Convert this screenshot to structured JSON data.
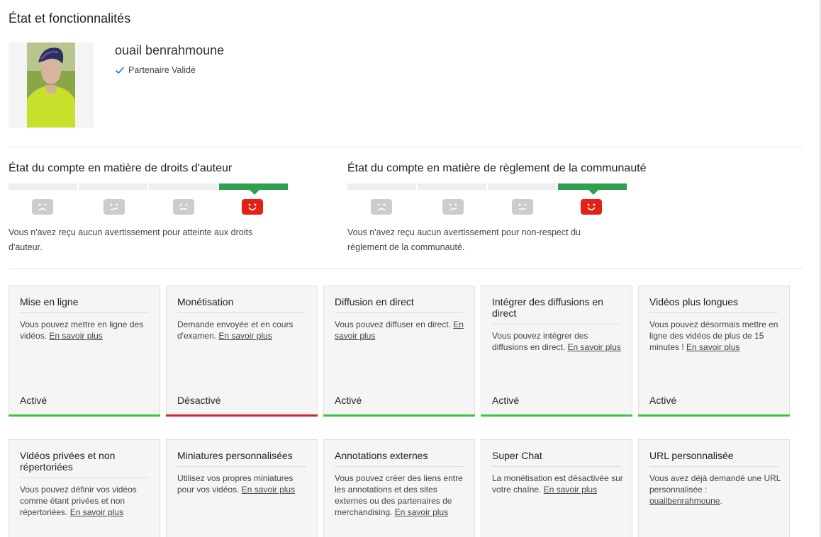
{
  "page": {
    "title": "État et fonctionnalités"
  },
  "channel": {
    "name": "ouail benrahmoune",
    "partner_label": "Partenaire Validé"
  },
  "copyright": {
    "title": "État du compte en matière de droits d'auteur",
    "text": "Vous n'avez reçu aucun avertissement pour atteinte aux droits d'auteur."
  },
  "community": {
    "title": "État du compte en matière de règlement de la communauté",
    "text": "Vous n'avez reçu aucun avertissement pour non-respect du règlement de la communauté."
  },
  "learn_more": "En savoir plus",
  "features": [
    {
      "title": "Mise en ligne",
      "desc": "Vous pouvez mettre en ligne des vidéos.",
      "link": "En savoir plus",
      "status": "Activé",
      "status_color": "#3ec43e"
    },
    {
      "title": "Monétisation",
      "desc": "Demande envoyée et en cours d'examen.",
      "link": "En savoir plus",
      "status": "Désactivé",
      "status_color": "#d32626"
    },
    {
      "title": "Diffusion en direct",
      "desc": "Vous pouvez diffuser en direct.",
      "link": "En savoir plus",
      "status": "Activé",
      "status_color": "#3ec43e"
    },
    {
      "title": "Intégrer des diffusions en direct",
      "desc": "Vous pouvez intégrer des diffusions en direct.",
      "link": "En savoir plus",
      "status": "Activé",
      "status_color": "#3ec43e"
    },
    {
      "title": "Vidéos plus longues",
      "desc": "Vous pouvez désormais mettre en ligne des vidéos de plus de 15 minutes !",
      "link": "En savoir plus",
      "status": "Activé",
      "status_color": "#3ec43e"
    },
    {
      "title": "Vidéos privées et non répertoriées",
      "desc": "Vous pouvez définir vos vidéos comme étant privées et non répertoriées.",
      "link": "En savoir plus"
    },
    {
      "title": "Miniatures personnalisées",
      "desc": "Utilisez vos propres miniatures pour vos vidéos.",
      "link": "En savoir plus"
    },
    {
      "title": "Annotations externes",
      "desc": "Vous pouvez créer des liens entre les annotations et des sites externes ou des partenaires de merchandising.",
      "link": "En savoir plus"
    },
    {
      "title": "Super Chat",
      "desc": "La monétisation est désactivée sur votre chaîne.",
      "link": "En savoir plus"
    },
    {
      "title": "URL personnalisée",
      "desc": "Vous avez déjà demandé une URL personnalisée :",
      "link": "ouailbenrahmoune",
      "link_suffix": "."
    }
  ],
  "colors": {
    "active_segment": "#2ea04e",
    "strike_face_ok": "#e52117",
    "strike_face_inactive": "#cccccc"
  },
  "icons": {
    "partner": "check-icon",
    "face_ok": "smile-face-icon",
    "face_bad": "sad-face-icon"
  }
}
